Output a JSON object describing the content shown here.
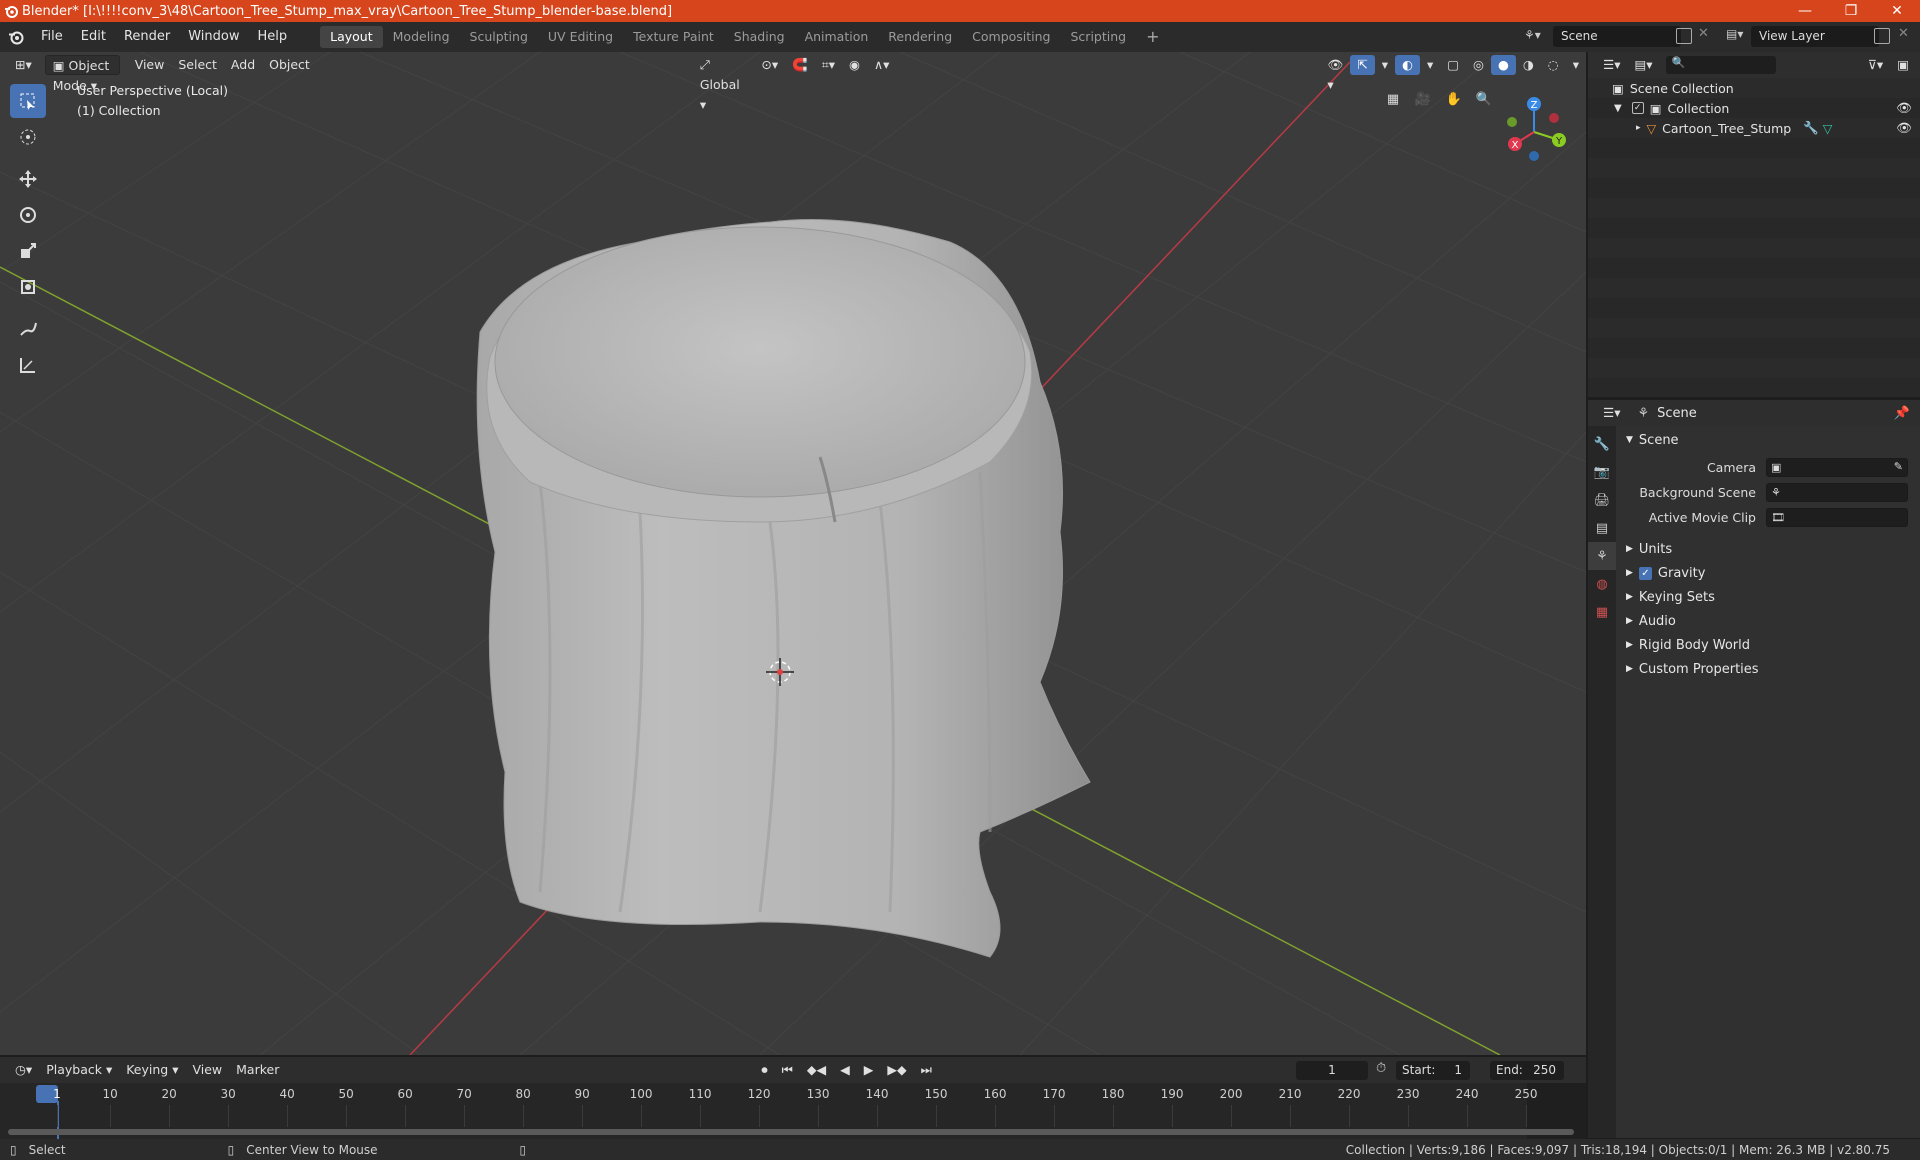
{
  "window": {
    "title": "Blender* [I:\\!!!!conv_3\\48\\Cartoon_Tree_Stump_max_vray\\Cartoon_Tree_Stump_blender-base.blend]",
    "controls": [
      "—",
      "❐",
      "✕"
    ]
  },
  "menu": [
    "File",
    "Edit",
    "Render",
    "Window",
    "Help"
  ],
  "workspaces": [
    "Layout",
    "Modeling",
    "Sculpting",
    "UV Editing",
    "Texture Paint",
    "Shading",
    "Animation",
    "Rendering",
    "Compositing",
    "Scripting"
  ],
  "active_workspace": "Layout",
  "scene_selector": {
    "value": "Scene"
  },
  "view_layer_selector": {
    "value": "View Layer"
  },
  "viewport": {
    "mode": "Object Mode",
    "menus": [
      "View",
      "Select",
      "Add",
      "Object"
    ],
    "transform_orientation": "Global",
    "overlay_lines": [
      "User Perspective (Local)",
      "(1) Collection"
    ],
    "gizmo_axes": {
      "x": "X",
      "y": "Y",
      "z": "Z"
    },
    "colors": {
      "background": "#3b3b3b",
      "grid": "#454545",
      "x_axis": "#b83a44",
      "y_axis": "#7fa12e",
      "mesh": "#bdbdbd",
      "x_gizmo": "#e0384f",
      "y_gizmo": "#8ccc22",
      "z_gizmo": "#3a8be6"
    }
  },
  "outliner": {
    "root": "Scene Collection",
    "items": [
      {
        "label": "Collection",
        "icon": "collection-icon"
      },
      {
        "label": "Cartoon_Tree_Stump",
        "icon": "mesh-object-icon"
      }
    ]
  },
  "properties": {
    "context": "Scene",
    "panel": "Scene",
    "rows": [
      {
        "label": "Camera",
        "value": ""
      },
      {
        "label": "Background Scene",
        "value": ""
      },
      {
        "label": "Active Movie Clip",
        "value": ""
      }
    ],
    "subpanels": [
      {
        "label": "Units",
        "checkbox": false
      },
      {
        "label": "Gravity",
        "checkbox": true
      },
      {
        "label": "Keying Sets",
        "checkbox": false
      },
      {
        "label": "Audio",
        "checkbox": false
      },
      {
        "label": "Rigid Body World",
        "checkbox": false
      },
      {
        "label": "Custom Properties",
        "checkbox": false
      }
    ]
  },
  "timeline": {
    "menus": [
      "Playback",
      "Keying",
      "View",
      "Marker"
    ],
    "current_frame": "1",
    "start_label": "Start:",
    "start": "1",
    "end_label": "End:",
    "end": "250",
    "ticks": [
      "1",
      "10",
      "20",
      "30",
      "40",
      "50",
      "60",
      "70",
      "80",
      "90",
      "100",
      "110",
      "120",
      "130",
      "140",
      "150",
      "160",
      "170",
      "180",
      "190",
      "200",
      "210",
      "220",
      "230",
      "240",
      "250"
    ]
  },
  "status": {
    "left_hint": "Select",
    "middle_hint": "Center View to Mouse",
    "stats": "Collection | Verts:9,186 | Faces:9,097 | Tris:18,194 | Objects:0/1 | Mem: 26.3 MB | v2.80.75"
  }
}
